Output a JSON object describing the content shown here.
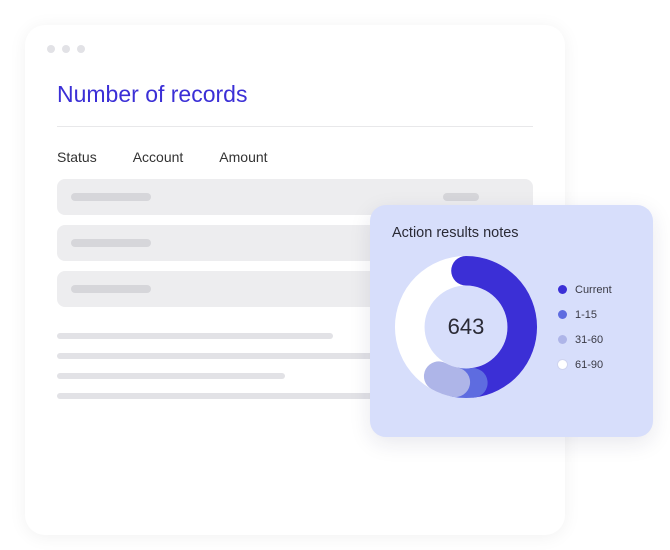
{
  "window": {
    "title": "Number of records",
    "columns": [
      "Status",
      "Account",
      "Amount"
    ]
  },
  "card": {
    "title": "Action results notes",
    "center_value": "643",
    "legend": [
      {
        "label": "Current",
        "color": "#3b2fd6"
      },
      {
        "label": "1-15",
        "color": "#5e6ce0"
      },
      {
        "label": "31-60",
        "color": "#aeb5e8"
      },
      {
        "label": "61-90",
        "color": "#ffffff"
      }
    ]
  },
  "chart_data": {
    "type": "pie",
    "title": "Action results notes",
    "center_label": 643,
    "categories": [
      "Current",
      "1-15",
      "31-60",
      "61-90"
    ],
    "values": [
      50,
      5,
      5,
      40
    ],
    "colors": [
      "#3b2fd6",
      "#5e6ce0",
      "#aeb5e8",
      "#ffffff"
    ],
    "note": "values are estimated arc percentages from the donut; 61-90 segment blends with white ring background"
  }
}
